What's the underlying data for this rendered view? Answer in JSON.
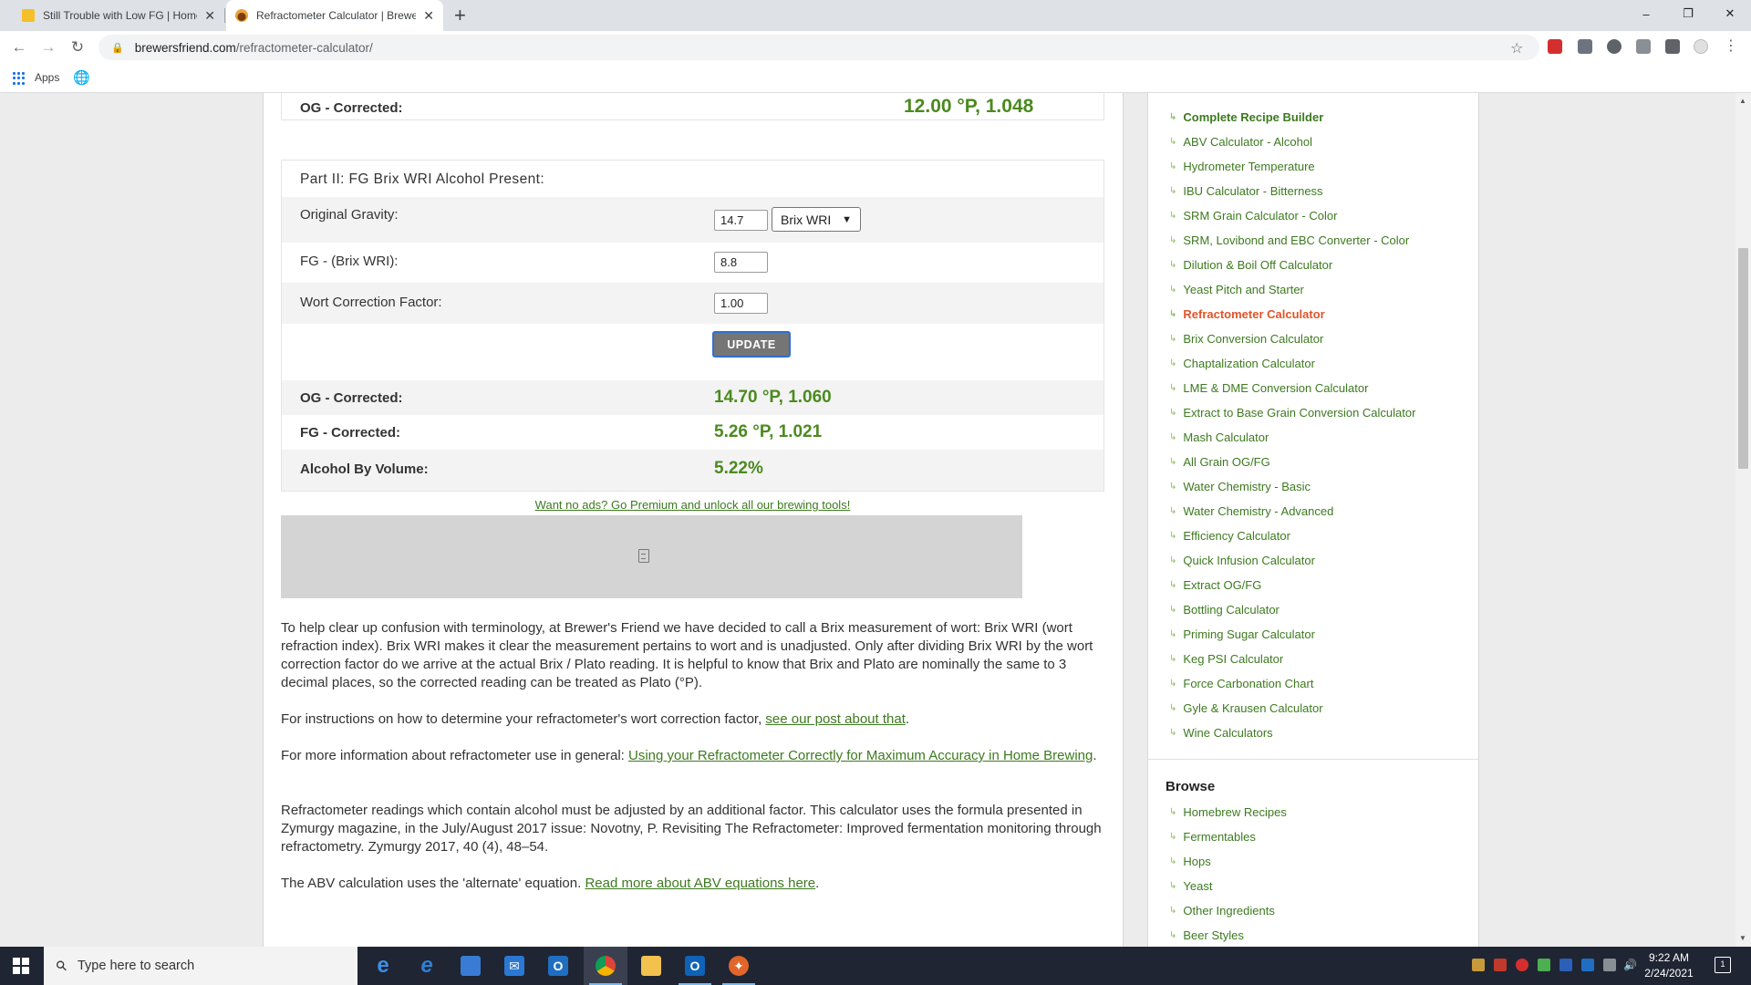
{
  "browser": {
    "tabs": [
      {
        "title": "Still Trouble with Low FG | Home",
        "active": false
      },
      {
        "title": "Refractometer Calculator | Brewe",
        "active": true
      }
    ],
    "new_tab": "+",
    "url_host": "brewersfriend.com",
    "url_path": "/refractometer-calculator/",
    "bookmarks": {
      "apps_label": "Apps"
    },
    "window_controls": {
      "minimize": "–",
      "maximize": "❐",
      "close": "✕"
    }
  },
  "calculator": {
    "part1_og_corrected_label": "OG - Corrected:",
    "part1_og_corrected_value": "12.00 °P, 1.048",
    "part2_title": "Part II: FG Brix WRI Alcohol Present:",
    "original_gravity_label": "Original Gravity:",
    "original_gravity_value": "14.7",
    "original_gravity_unit": "Brix WRI",
    "fg_label": "FG - (Brix WRI):",
    "fg_value": "8.8",
    "wcf_label": "Wort Correction Factor:",
    "wcf_value": "1.00",
    "update_label": "UPDATE",
    "results": {
      "og_label": "OG - Corrected:",
      "og_value": "14.70 °P, 1.060",
      "fg_label": "FG - Corrected:",
      "fg_value": "5.26 °P, 1.021",
      "abv_label": "Alcohol By Volume:",
      "abv_value": "5.22%"
    }
  },
  "premium_link": "Want no ads? Go Premium and unlock all our brewing tools!",
  "paragraphs": {
    "p1": "To help clear up confusion with terminology, at Brewer's Friend we have decided to call a Brix measurement of wort: Brix WRI (wort refraction index). Brix WRI makes it clear the measurement pertains to wort and is unadjusted. Only after dividing Brix WRI by the wort correction factor do we arrive at the actual Brix / Plato reading. It is helpful to know that Brix and Plato are nominally the same to 3 decimal places, so the corrected reading can be treated as Plato (°P).",
    "p2_text": "For instructions on how to determine your refractometer's wort correction factor, ",
    "p2_link": "see our post about that",
    "p2_end": ".",
    "p3_text": "For more information about refractometer use in general: ",
    "p3_link": "Using your Refractometer Correctly for Maximum Accuracy in Home Brewing",
    "p3_end": ".",
    "p4": "Refractometer readings which contain alcohol must be adjusted by an additional factor. This calculator uses the formula presented in Zymurgy magazine, in the July/August 2017 issue: Novotny, P. Revisiting The Refractometer: Improved fermentation monitoring through refractometry. Zymurgy 2017, 40 (4), 48–54.",
    "p5_text": "The ABV calculation uses the 'alternate' equation. ",
    "p5_link": "Read more about ABV equations here",
    "p5_end": "."
  },
  "sidebar": {
    "tools": [
      "Complete Recipe Builder",
      "ABV Calculator - Alcohol",
      "Hydrometer Temperature",
      "IBU Calculator - Bitterness",
      "SRM Grain Calculator - Color",
      "SRM, Lovibond and EBC Converter - Color",
      "Dilution & Boil Off Calculator",
      "Yeast Pitch and Starter",
      "Refractometer Calculator",
      "Brix Conversion Calculator",
      "Chaptalization Calculator",
      "LME & DME Conversion Calculator",
      "Extract to Base Grain Conversion Calculator",
      "Mash Calculator",
      "All Grain OG/FG",
      "Water Chemistry - Basic",
      "Water Chemistry - Advanced",
      "Efficiency Calculator",
      "Quick Infusion Calculator",
      "Extract OG/FG",
      "Bottling Calculator",
      "Priming Sugar Calculator",
      "Keg PSI Calculator",
      "Force Carbonation Chart",
      "Gyle & Krausen Calculator",
      "Wine Calculators"
    ],
    "browse_title": "Browse",
    "browse": [
      "Homebrew Recipes",
      "Fermentables",
      "Hops",
      "Yeast",
      "Other Ingredients",
      "Beer Styles"
    ]
  },
  "taskbar": {
    "search_placeholder": "Type here to search",
    "time": "9:22 AM",
    "date": "2/24/2021",
    "notifications": "1"
  },
  "colors": {
    "accent_green": "#4b8a1f",
    "link_green": "#3d7a1f",
    "active_orange": "#e0542a"
  }
}
